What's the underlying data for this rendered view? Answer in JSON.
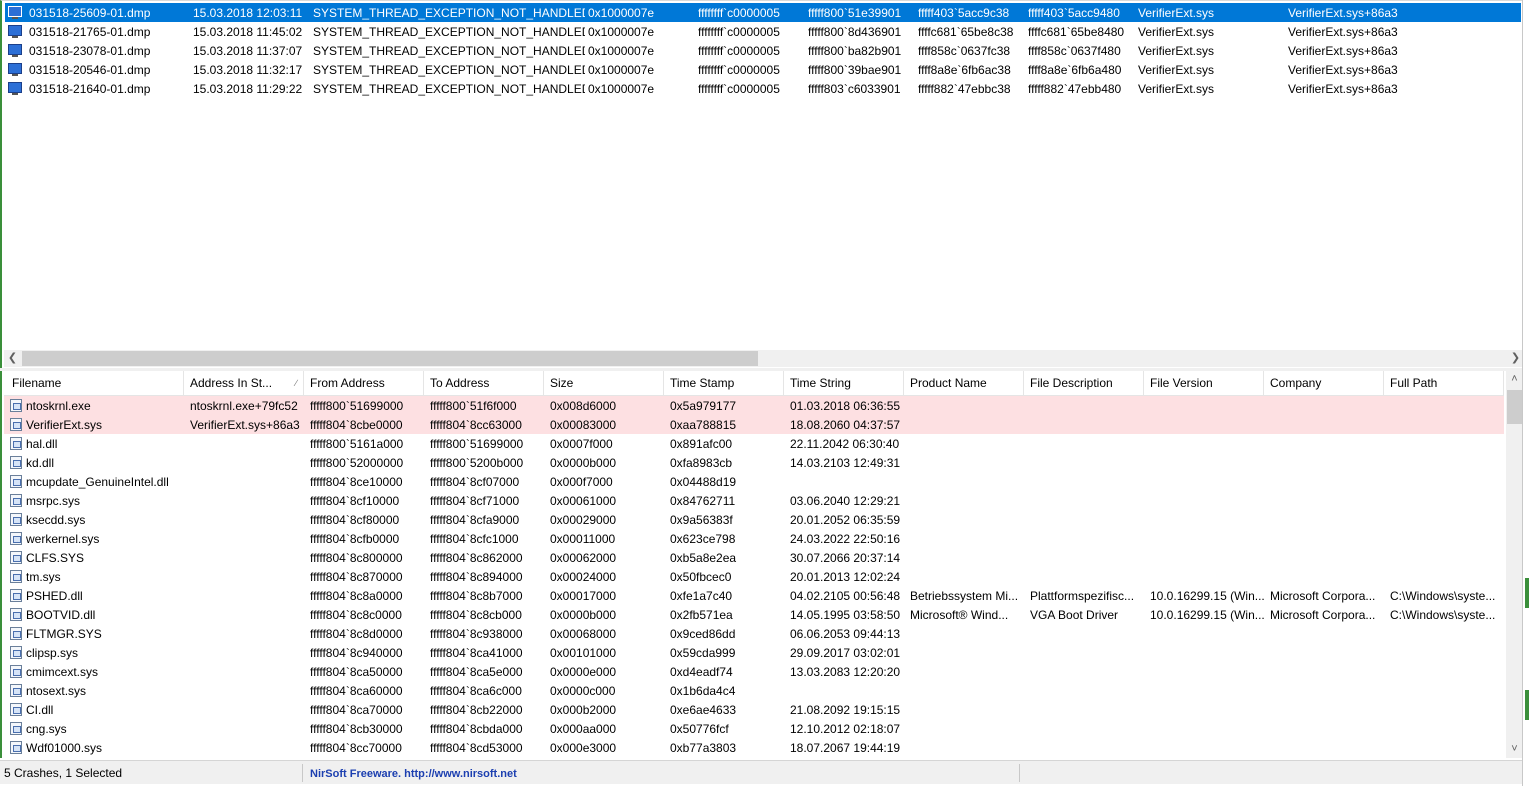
{
  "crashes": [
    {
      "dump": "031518-25609-01.dmp",
      "time": "15.03.2018 12:03:11",
      "bugcheck": "SYSTEM_THREAD_EXCEPTION_NOT_HANDLED",
      "code": "0x1000007e",
      "p1": "ffffffff`c0000005",
      "p2": "fffff800`51e39901",
      "p3": "fffff403`5acc9c38",
      "p4": "fffff403`5acc9480",
      "driver": "VerifierExt.sys",
      "address": "VerifierExt.sys+86a3",
      "selected": true
    },
    {
      "dump": "031518-21765-01.dmp",
      "time": "15.03.2018 11:45:02",
      "bugcheck": "SYSTEM_THREAD_EXCEPTION_NOT_HANDLED",
      "code": "0x1000007e",
      "p1": "ffffffff`c0000005",
      "p2": "fffff800`8d436901",
      "p3": "ffffc681`65be8c38",
      "p4": "ffffc681`65be8480",
      "driver": "VerifierExt.sys",
      "address": "VerifierExt.sys+86a3",
      "selected": false
    },
    {
      "dump": "031518-23078-01.dmp",
      "time": "15.03.2018 11:37:07",
      "bugcheck": "SYSTEM_THREAD_EXCEPTION_NOT_HANDLED",
      "code": "0x1000007e",
      "p1": "ffffffff`c0000005",
      "p2": "fffff800`ba82b901",
      "p3": "ffff858c`0637fc38",
      "p4": "ffff858c`0637f480",
      "driver": "VerifierExt.sys",
      "address": "VerifierExt.sys+86a3",
      "selected": false
    },
    {
      "dump": "031518-20546-01.dmp",
      "time": "15.03.2018 11:32:17",
      "bugcheck": "SYSTEM_THREAD_EXCEPTION_NOT_HANDLED",
      "code": "0x1000007e",
      "p1": "ffffffff`c0000005",
      "p2": "fffff800`39bae901",
      "p3": "ffff8a8e`6fb6ac38",
      "p4": "ffff8a8e`6fb6a480",
      "driver": "VerifierExt.sys",
      "address": "VerifierExt.sys+86a3",
      "selected": false
    },
    {
      "dump": "031518-21640-01.dmp",
      "time": "15.03.2018 11:29:22",
      "bugcheck": "SYSTEM_THREAD_EXCEPTION_NOT_HANDLED",
      "code": "0x1000007e",
      "p1": "ffffffff`c0000005",
      "p2": "fffff803`c6033901",
      "p3": "fffff882`47ebbc38",
      "p4": "fffff882`47ebb480",
      "driver": "VerifierExt.sys",
      "address": "VerifierExt.sys+86a3",
      "selected": false
    }
  ],
  "columns": [
    "Filename",
    "Address In St...",
    "From Address",
    "To Address",
    "Size",
    "Time Stamp",
    "Time String",
    "Product Name",
    "File Description",
    "File Version",
    "Company",
    "Full Path"
  ],
  "modules": [
    {
      "name": "ntoskrnl.exe",
      "addr": "ntoskrnl.exe+79fc52",
      "from": "fffff800`51699000",
      "to": "fffff800`51f6f000",
      "size": "0x008d6000",
      "stamp": "0x5a979177",
      "tstr": "01.03.2018 06:36:55",
      "product": "",
      "desc": "",
      "ver": "",
      "company": "",
      "path": "",
      "highlight": true
    },
    {
      "name": "VerifierExt.sys",
      "addr": "VerifierExt.sys+86a3",
      "from": "fffff804`8cbe0000",
      "to": "fffff804`8cc63000",
      "size": "0x00083000",
      "stamp": "0xaa788815",
      "tstr": "18.08.2060 04:37:57",
      "product": "",
      "desc": "",
      "ver": "",
      "company": "",
      "path": "",
      "highlight": true
    },
    {
      "name": "hal.dll",
      "addr": "",
      "from": "fffff800`5161a000",
      "to": "fffff800`51699000",
      "size": "0x0007f000",
      "stamp": "0x891afc00",
      "tstr": "22.11.2042 06:30:40",
      "product": "",
      "desc": "",
      "ver": "",
      "company": "",
      "path": "",
      "highlight": false
    },
    {
      "name": "kd.dll",
      "addr": "",
      "from": "fffff800`52000000",
      "to": "fffff800`5200b000",
      "size": "0x0000b000",
      "stamp": "0xfa8983cb",
      "tstr": "14.03.2103 12:49:31",
      "product": "",
      "desc": "",
      "ver": "",
      "company": "",
      "path": "",
      "highlight": false
    },
    {
      "name": "mcupdate_GenuineIntel.dll",
      "addr": "",
      "from": "fffff804`8ce10000",
      "to": "fffff804`8cf07000",
      "size": "0x000f7000",
      "stamp": "0x04488d19",
      "tstr": "",
      "product": "",
      "desc": "",
      "ver": "",
      "company": "",
      "path": "",
      "highlight": false
    },
    {
      "name": "msrpc.sys",
      "addr": "",
      "from": "fffff804`8cf10000",
      "to": "fffff804`8cf71000",
      "size": "0x00061000",
      "stamp": "0x84762711",
      "tstr": "03.06.2040 12:29:21",
      "product": "",
      "desc": "",
      "ver": "",
      "company": "",
      "path": "",
      "highlight": false
    },
    {
      "name": "ksecdd.sys",
      "addr": "",
      "from": "fffff804`8cf80000",
      "to": "fffff804`8cfa9000",
      "size": "0x00029000",
      "stamp": "0x9a56383f",
      "tstr": "20.01.2052 06:35:59",
      "product": "",
      "desc": "",
      "ver": "",
      "company": "",
      "path": "",
      "highlight": false
    },
    {
      "name": "werkernel.sys",
      "addr": "",
      "from": "fffff804`8cfb0000",
      "to": "fffff804`8cfc1000",
      "size": "0x00011000",
      "stamp": "0x623ce798",
      "tstr": "24.03.2022 22:50:16",
      "product": "",
      "desc": "",
      "ver": "",
      "company": "",
      "path": "",
      "highlight": false
    },
    {
      "name": "CLFS.SYS",
      "addr": "",
      "from": "fffff804`8c800000",
      "to": "fffff804`8c862000",
      "size": "0x00062000",
      "stamp": "0xb5a8e2ea",
      "tstr": "30.07.2066 20:37:14",
      "product": "",
      "desc": "",
      "ver": "",
      "company": "",
      "path": "",
      "highlight": false
    },
    {
      "name": "tm.sys",
      "addr": "",
      "from": "fffff804`8c870000",
      "to": "fffff804`8c894000",
      "size": "0x00024000",
      "stamp": "0x50fbcec0",
      "tstr": "20.01.2013 12:02:24",
      "product": "",
      "desc": "",
      "ver": "",
      "company": "",
      "path": "",
      "highlight": false
    },
    {
      "name": "PSHED.dll",
      "addr": "",
      "from": "fffff804`8c8a0000",
      "to": "fffff804`8c8b7000",
      "size": "0x00017000",
      "stamp": "0xfe1a7c40",
      "tstr": "04.02.2105 00:56:48",
      "product": "Betriebssystem Mi...",
      "desc": "Plattformspezifisc...",
      "ver": "10.0.16299.15 (Win...",
      "company": "Microsoft Corpora...",
      "path": "C:\\Windows\\syste...",
      "highlight": false
    },
    {
      "name": "BOOTVID.dll",
      "addr": "",
      "from": "fffff804`8c8c0000",
      "to": "fffff804`8c8cb000",
      "size": "0x0000b000",
      "stamp": "0x2fb571ea",
      "tstr": "14.05.1995 03:58:50",
      "product": "Microsoft® Wind...",
      "desc": "VGA Boot Driver",
      "ver": "10.0.16299.15 (Win...",
      "company": "Microsoft Corpora...",
      "path": "C:\\Windows\\syste...",
      "highlight": false
    },
    {
      "name": "FLTMGR.SYS",
      "addr": "",
      "from": "fffff804`8c8d0000",
      "to": "fffff804`8c938000",
      "size": "0x00068000",
      "stamp": "0x9ced86dd",
      "tstr": "06.06.2053 09:44:13",
      "product": "",
      "desc": "",
      "ver": "",
      "company": "",
      "path": "",
      "highlight": false
    },
    {
      "name": "clipsp.sys",
      "addr": "",
      "from": "fffff804`8c940000",
      "to": "fffff804`8ca41000",
      "size": "0x00101000",
      "stamp": "0x59cda999",
      "tstr": "29.09.2017 03:02:01",
      "product": "",
      "desc": "",
      "ver": "",
      "company": "",
      "path": "",
      "highlight": false
    },
    {
      "name": "cmimcext.sys",
      "addr": "",
      "from": "fffff804`8ca50000",
      "to": "fffff804`8ca5e000",
      "size": "0x0000e000",
      "stamp": "0xd4eadf74",
      "tstr": "13.03.2083 12:20:20",
      "product": "",
      "desc": "",
      "ver": "",
      "company": "",
      "path": "",
      "highlight": false
    },
    {
      "name": "ntosext.sys",
      "addr": "",
      "from": "fffff804`8ca60000",
      "to": "fffff804`8ca6c000",
      "size": "0x0000c000",
      "stamp": "0x1b6da4c4",
      "tstr": "",
      "product": "",
      "desc": "",
      "ver": "",
      "company": "",
      "path": "",
      "highlight": false
    },
    {
      "name": "CI.dll",
      "addr": "",
      "from": "fffff804`8ca70000",
      "to": "fffff804`8cb22000",
      "size": "0x000b2000",
      "stamp": "0xe6ae4633",
      "tstr": "21.08.2092 19:15:15",
      "product": "",
      "desc": "",
      "ver": "",
      "company": "",
      "path": "",
      "highlight": false
    },
    {
      "name": "cng.sys",
      "addr": "",
      "from": "fffff804`8cb30000",
      "to": "fffff804`8cbda000",
      "size": "0x000aa000",
      "stamp": "0x50776fcf",
      "tstr": "12.10.2012 02:18:07",
      "product": "",
      "desc": "",
      "ver": "",
      "company": "",
      "path": "",
      "highlight": false
    },
    {
      "name": "Wdf01000.sys",
      "addr": "",
      "from": "fffff804`8cc70000",
      "to": "fffff804`8cd53000",
      "size": "0x000e3000",
      "stamp": "0xb77a3803",
      "tstr": "18.07.2067 19:44:19",
      "product": "",
      "desc": "",
      "ver": "",
      "company": "",
      "path": "",
      "highlight": false
    }
  ],
  "status": {
    "count": "5 Crashes, 1 Selected",
    "link": "NirSoft Freeware.  http://www.nirsoft.net"
  },
  "colors": {
    "selection": "#0078d7",
    "highlight_row": "#fde0e2",
    "link": "#1c3fb0"
  },
  "icons": {
    "crash_row": "monitor-icon",
    "module_row": "file-icon",
    "scroll_left": "arrow-left-icon",
    "scroll_right": "arrow-right-icon",
    "scroll_up": "arrow-up-icon",
    "scroll_down": "arrow-down-icon"
  }
}
